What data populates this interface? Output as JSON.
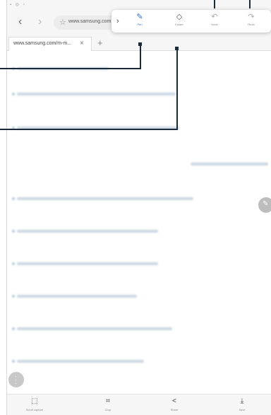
{
  "browser": {
    "url": "www.samsung.com",
    "tab_title": "www.samsung.com/m-m...",
    "tab_close": "×",
    "tab_add": "+",
    "back_glyph": "‹",
    "forward_glyph": "›"
  },
  "edit_toolbar": {
    "chevron": "›",
    "items": [
      {
        "label": "Pen",
        "icon": "pen-icon"
      },
      {
        "label": "Eraser",
        "icon": "eraser-icon"
      },
      {
        "label": "Undo",
        "icon": "undo-icon"
      },
      {
        "label": "Redo",
        "icon": "redo-icon"
      }
    ],
    "active_color": "#2f6fd8"
  },
  "bottom_bar": {
    "items": [
      {
        "label": "Scroll capture",
        "icon": "scroll-capture-icon"
      },
      {
        "label": "Crop",
        "icon": "crop-icon"
      },
      {
        "label": "Share",
        "icon": "share-icon"
      },
      {
        "label": "Save",
        "icon": "save-icon"
      }
    ]
  },
  "colors": {
    "callout": "#1a2a3a",
    "blurred_text": "#b8c8d8"
  }
}
